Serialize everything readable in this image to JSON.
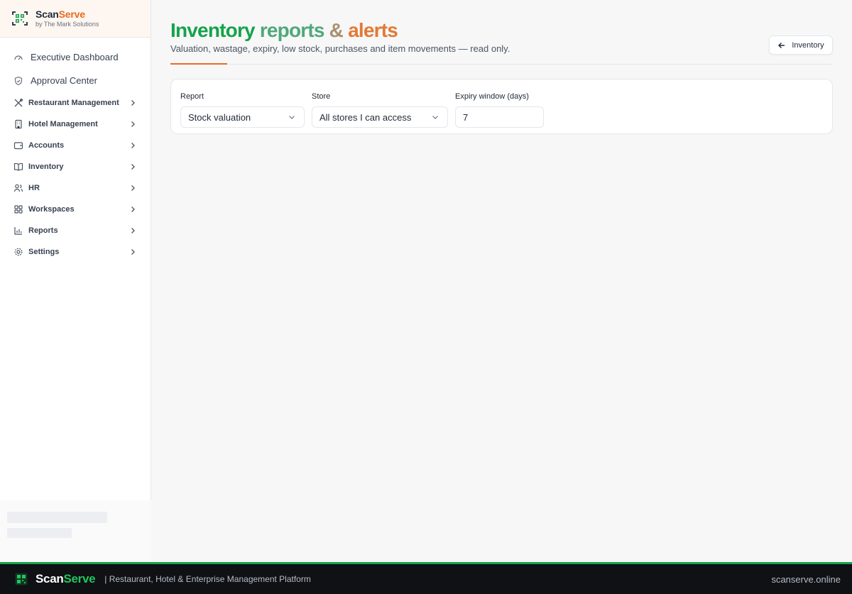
{
  "brand": {
    "name_scan": "Scan",
    "name_serve": "Serve",
    "sub": "by The Mark Solutions"
  },
  "sidebar": {
    "top_items": [
      {
        "label": "Executive Dashboard",
        "icon": "gauge-icon"
      },
      {
        "label": "Approval Center",
        "icon": "shield-check-icon"
      }
    ],
    "sections": [
      {
        "label": "Restaurant Management",
        "icon": "utensils-icon"
      },
      {
        "label": "Hotel Management",
        "icon": "building-icon"
      },
      {
        "label": "Accounts",
        "icon": "wallet-icon"
      },
      {
        "label": "Inventory",
        "icon": "book-icon"
      },
      {
        "label": "HR",
        "icon": "users-icon"
      },
      {
        "label": "Workspaces",
        "icon": "grid-icon"
      },
      {
        "label": "Reports",
        "icon": "bar-chart-icon"
      },
      {
        "label": "Settings",
        "icon": "gear-icon"
      }
    ]
  },
  "page": {
    "title_1": "Inventory",
    "title_2": "reports",
    "title_3": "&",
    "title_4": "alerts",
    "subtitle": "Valuation, wastage, expiry, low stock, purchases and item movements — read only.",
    "back_label": "Inventory"
  },
  "filters": {
    "report": {
      "label": "Report",
      "value": "Stock valuation"
    },
    "store": {
      "label": "Store",
      "value": "All stores I can access"
    },
    "expiry": {
      "label": "Expiry window (days)",
      "value": "7"
    }
  },
  "footer": {
    "name_scan": "Scan",
    "name_serve": "Serve",
    "tagline": "| Restaurant, Hotel & Enterprise Management Platform",
    "url": "scanserve.online"
  },
  "colors": {
    "accent_orange": "#ea6b1e",
    "accent_green": "#16a34a"
  }
}
